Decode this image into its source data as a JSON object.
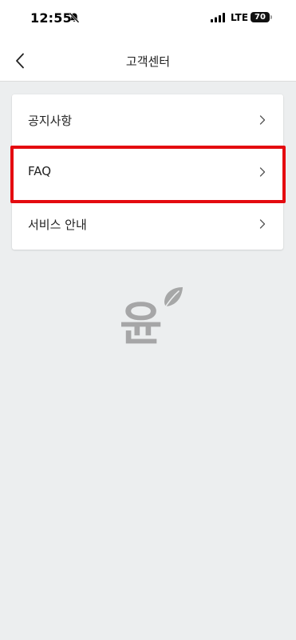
{
  "status_bar": {
    "time": "12:55",
    "network": "LTE",
    "battery": "70"
  },
  "header": {
    "title": "고객센터"
  },
  "menu": {
    "items": [
      {
        "label": "공지사항"
      },
      {
        "label": "FAQ"
      },
      {
        "label": "서비스 안내"
      }
    ]
  },
  "watermark": {
    "glyph": "윤"
  },
  "colors": {
    "highlight": "#e40b10",
    "background": "#eceeef",
    "watermark": "#8f8f8f"
  },
  "icons": [
    "bell-slash-icon",
    "signal-bars-icon",
    "battery-icon",
    "chevron-left-icon",
    "chevron-right-icon",
    "leaf-icon"
  ]
}
